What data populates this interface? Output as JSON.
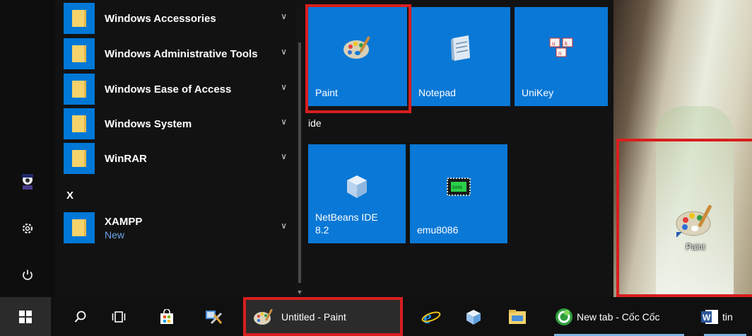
{
  "start_menu": {
    "apps": [
      {
        "label": "Windows Accessories",
        "sub": ""
      },
      {
        "label": "Windows Administrative Tools",
        "sub": ""
      },
      {
        "label": "Windows Ease of Access",
        "sub": ""
      },
      {
        "label": "Windows System",
        "sub": ""
      },
      {
        "label": "WinRAR",
        "sub": ""
      },
      {
        "label": "XAMPP",
        "sub": "New"
      }
    ],
    "section_letter": "X",
    "rail_icons": [
      "user-avatar-icon",
      "settings-gear-icon",
      "power-icon"
    ]
  },
  "tiles": {
    "top_row": [
      {
        "label": "Paint",
        "icon": "paint-palette-icon"
      },
      {
        "label": "Notepad",
        "icon": "notepad-icon"
      },
      {
        "label": "UniKey",
        "icon": "unikey-icon"
      }
    ],
    "group_label": "ide",
    "bottom_row": [
      {
        "label": "NetBeans IDE 8.2",
        "icon": "netbeans-cube-icon"
      },
      {
        "label": "emu8086",
        "icon": "emu8086-chip-icon"
      }
    ]
  },
  "desktop": {
    "shortcut_label": "Paint"
  },
  "taskbar": {
    "start_icon": "windows-logo-icon",
    "search_icon": "search-icon",
    "task_view_icon": "task-view-icon",
    "store_icon": "store-icon",
    "tools_icon": "tools-icon",
    "paint_window_label": "Untitled - Paint",
    "ie_icon": "internet-explorer-icon",
    "cube_icon": "app-cube-icon",
    "explorer_icon": "file-explorer-icon",
    "browser_label": "New tab - Cốc Cốc",
    "word_label": "tin"
  },
  "colors": {
    "tile_blue": "#0a78d6",
    "highlight_red": "#d81e1e",
    "taskbar_bg": "#101010"
  }
}
